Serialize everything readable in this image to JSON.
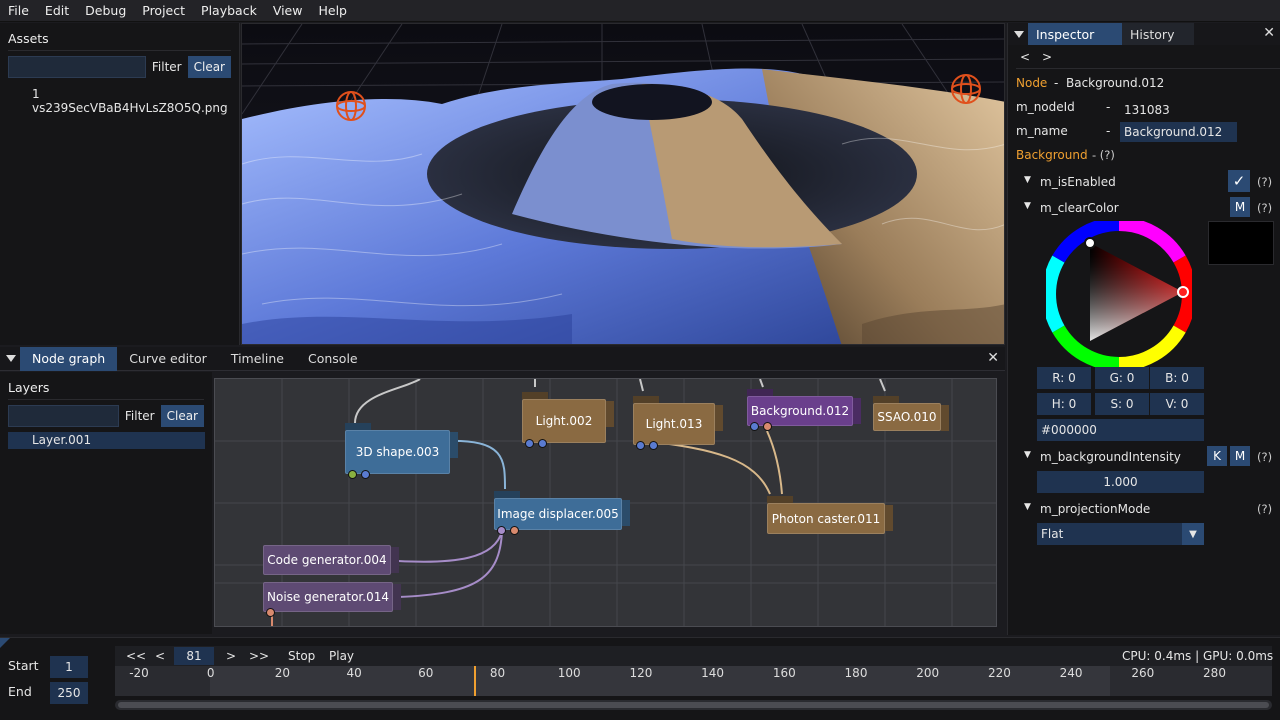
{
  "menu": [
    "File",
    "Edit",
    "Debug",
    "Project",
    "Playback",
    "View",
    "Help"
  ],
  "assets": {
    "title": "Assets",
    "filter_label": "Filter",
    "clear_label": "Clear",
    "items": [
      "1 vs239SecVBaB4HvLsZ8O5Q.png"
    ]
  },
  "bottom_tabs": [
    "Node graph",
    "Curve editor",
    "Timeline",
    "Console"
  ],
  "layers": {
    "title": "Layers",
    "filter_label": "Filter",
    "clear_label": "Clear",
    "items": [
      "Layer.001"
    ]
  },
  "nodes": [
    {
      "label": "3D shape.003"
    },
    {
      "label": "Light.002"
    },
    {
      "label": "Light.013"
    },
    {
      "label": "Background.012"
    },
    {
      "label": "SSAO.010"
    },
    {
      "label": "Image displacer.005"
    },
    {
      "label": "Photon caster.011"
    },
    {
      "label": "Code generator.004"
    },
    {
      "label": "Noise generator.014"
    }
  ],
  "inspector": {
    "tabs": [
      "Inspector",
      "History"
    ],
    "nav_back": "<",
    "nav_fwd": ">",
    "node_label": "Node",
    "node_dash": "-",
    "node_value": "Background.012",
    "nodeid_label": "m_nodeId",
    "nodeid_value": "131083",
    "name_label": "m_name",
    "name_value": "Background.012",
    "section": "Background",
    "section_help": "- (?)",
    "dash": "-",
    "help": "(?)",
    "is_enabled": "m_isEnabled",
    "clear_color": "m_clearColor",
    "m_btn": "M",
    "k_btn": "K",
    "check_glyph": "✓",
    "r": "R: 0",
    "g": "G: 0",
    "b": "B: 0",
    "h": "H: 0",
    "s": "S: 0",
    "v": "V: 0",
    "hex": "#000000",
    "bg_intensity": "m_backgroundIntensity",
    "bg_intensity_value": "1.000",
    "proj_mode": "m_projectionMode",
    "proj_value": "Flat",
    "swatch_color": "#000000"
  },
  "timeline": {
    "start_label": "Start",
    "start_value": "1",
    "end_label": "End",
    "end_value": "250",
    "btn_first": "<<",
    "btn_prev": "<",
    "frame": "81",
    "btn_next": ">",
    "btn_last": ">>",
    "stop": "Stop",
    "play": "Play",
    "perf": "CPU: 0.4ms | GPU: 0.0ms",
    "ticks": [
      "-20",
      "0",
      "20",
      "40",
      "60",
      "80",
      "100",
      "120",
      "140",
      "160",
      "180",
      "200",
      "220",
      "240",
      "260",
      "280"
    ],
    "current_frame": 81,
    "accent": "#f0a030"
  },
  "colors": {
    "accent_blue": "#2b4a73",
    "orange": "#f0a030"
  }
}
